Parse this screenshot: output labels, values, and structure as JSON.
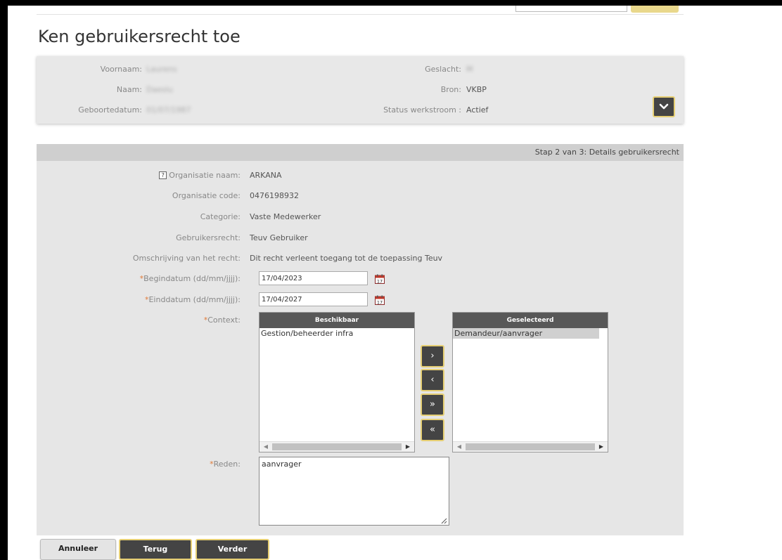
{
  "page": {
    "title": "Ken gebruikersrecht toe"
  },
  "user": {
    "first_name_label": "Voornaam:",
    "first_name_value": "Laurens",
    "last_name_label": "Naam:",
    "last_name_value": "Daeslu",
    "birthdate_label": "Geboortedatum:",
    "birthdate_value": "01/07/1987",
    "gender_label": "Geslacht:",
    "gender_value": "M",
    "source_label": "Bron:",
    "source_value": "VKBP",
    "workflow_status_label": "Status werkstroom :",
    "workflow_status_value": "Actief",
    "expand_icon": "chevron-down-icon"
  },
  "step": {
    "text": "Stap 2 van 3: Details gebruikersrecht"
  },
  "form": {
    "help_icon_text": "?",
    "org_name_label": "Organisatie naam:",
    "org_name_value": "ARKANA",
    "org_code_label": "Organisatie code:",
    "org_code_value": "0476198932",
    "category_label": "Categorie:",
    "category_value": "Vaste Medewerker",
    "right_label": "Gebruikersrecht:",
    "right_value": "Teuv Gebruiker",
    "description_label": "Omschrijving van het recht:",
    "description_value": "Dit recht verleent toegang tot de toepassing Teuv",
    "required_marker": "*",
    "begin_date_label": "Begindatum (dd/mm/jjjj):",
    "begin_date_value": "17/04/2023",
    "end_date_label": "Einddatum (dd/mm/jjjj):",
    "end_date_value": "17/04/2027",
    "calendar_day": "17",
    "context_label": "Context:",
    "available_header": "Beschikbaar",
    "available_items": [
      "Gestion/beheerder infra"
    ],
    "selected_header": "Geselecteerd",
    "selected_items": [
      "Demandeur/aanvrager"
    ],
    "move_buttons": [
      "›",
      "‹",
      "»",
      "«"
    ],
    "reason_label": "Reden:",
    "reason_value": "aanvrager"
  },
  "buttons": {
    "cancel": "Annuleer",
    "back": "Terug",
    "next": "Verder"
  },
  "colors": {
    "accent_border": "#e6cf74",
    "dark_button": "#444444",
    "required": "#e07b39",
    "list_header": "#585858"
  }
}
